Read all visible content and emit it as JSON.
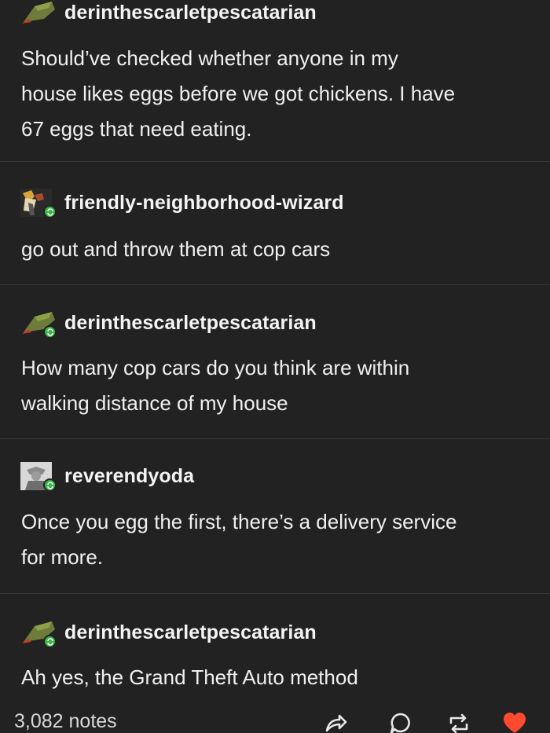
{
  "posts": [
    {
      "username": "derinthescarletpescatarian",
      "avatar_icon": "dragon-avatar-icon",
      "reblog_badge": false,
      "text_lines": [
        "Should’ve checked whether anyone in my",
        "house likes eggs before we got chickens. I have",
        "67 eggs that need eating."
      ]
    },
    {
      "username": "friendly-neighborhood-wizard",
      "avatar_icon": "wizard-avatar-icon",
      "reblog_badge": true,
      "text_lines": [
        "go out and throw them at cop cars"
      ]
    },
    {
      "username": "derinthescarletpescatarian",
      "avatar_icon": "dragon-avatar-icon",
      "reblog_badge": true,
      "text_lines": [
        "How many cop cars do you think are within",
        "walking distance of my house"
      ]
    },
    {
      "username": "reverendyoda",
      "avatar_icon": "yoda-avatar-icon",
      "reblog_badge": true,
      "text_lines": [
        "Once you egg the first, there’s a delivery service",
        "for more."
      ]
    },
    {
      "username": "derinthescarletpescatarian",
      "avatar_icon": "dragon-avatar-icon",
      "reblog_badge": true,
      "text_lines": [
        "Ah yes, the Grand Theft Auto method"
      ]
    }
  ],
  "footer": {
    "notes": "3,082 notes",
    "actions": [
      "share-icon",
      "reply-icon",
      "reblog-icon",
      "like-icon"
    ],
    "like_color": "#ff4930"
  },
  "colors": {
    "background": "#222222",
    "reblog_badge": "#3bb54a"
  }
}
